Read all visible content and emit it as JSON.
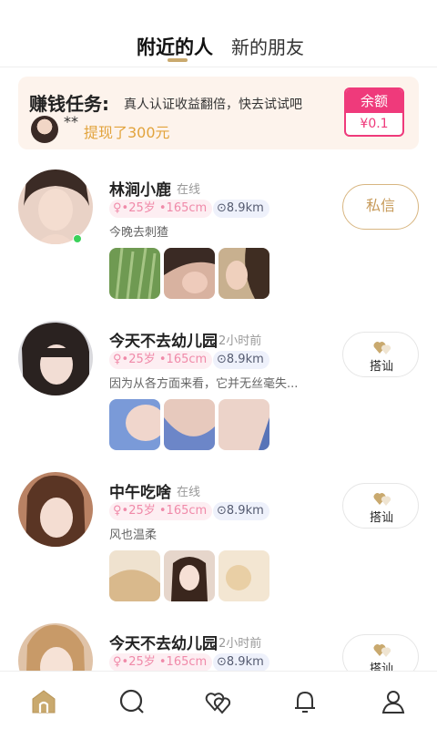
{
  "header": {
    "tab_active": "附近的人",
    "tab_inactive": "新的朋友"
  },
  "task": {
    "title": "赚钱任务:",
    "desc": "真人认证收益翻倍，快去试试吧",
    "masked_name": "**",
    "withdraw_text": "提现了300元",
    "balance_label": "余额",
    "balance_value": "¥0.1"
  },
  "users": [
    {
      "name": "林涧小鹿",
      "status": "在线",
      "age": "•25岁 •165cm",
      "distance": "8.9km",
      "bio": "今晚去刺猹",
      "button": "私信",
      "online": true
    },
    {
      "name": "今天不去幼儿园",
      "status": "2小时前",
      "age": "•25岁 •165cm",
      "distance": "8.9km",
      "bio": "因为从各方面来看，它并无丝毫失...",
      "button": "搭讪",
      "online": false
    },
    {
      "name": "中午吃啥",
      "status": "在线",
      "age": "•25岁 •165cm",
      "distance": "8.9km",
      "bio": "风也温柔",
      "button": "搭讪",
      "online": false
    },
    {
      "name": "今天不去幼儿园",
      "status": "2小时前",
      "age": "•25岁 •165cm",
      "distance": "8.9km",
      "bio": "",
      "button": "搭讪",
      "online": false
    }
  ],
  "tabbar": {
    "icons": [
      "home-icon",
      "discover-icon",
      "hearts-icon",
      "bell-icon",
      "profile-icon"
    ],
    "active_color": "#c9a96e"
  },
  "colors": {
    "accent": "#c9a96e",
    "balance": "#ef3a7b",
    "online": "#3ad15a"
  }
}
